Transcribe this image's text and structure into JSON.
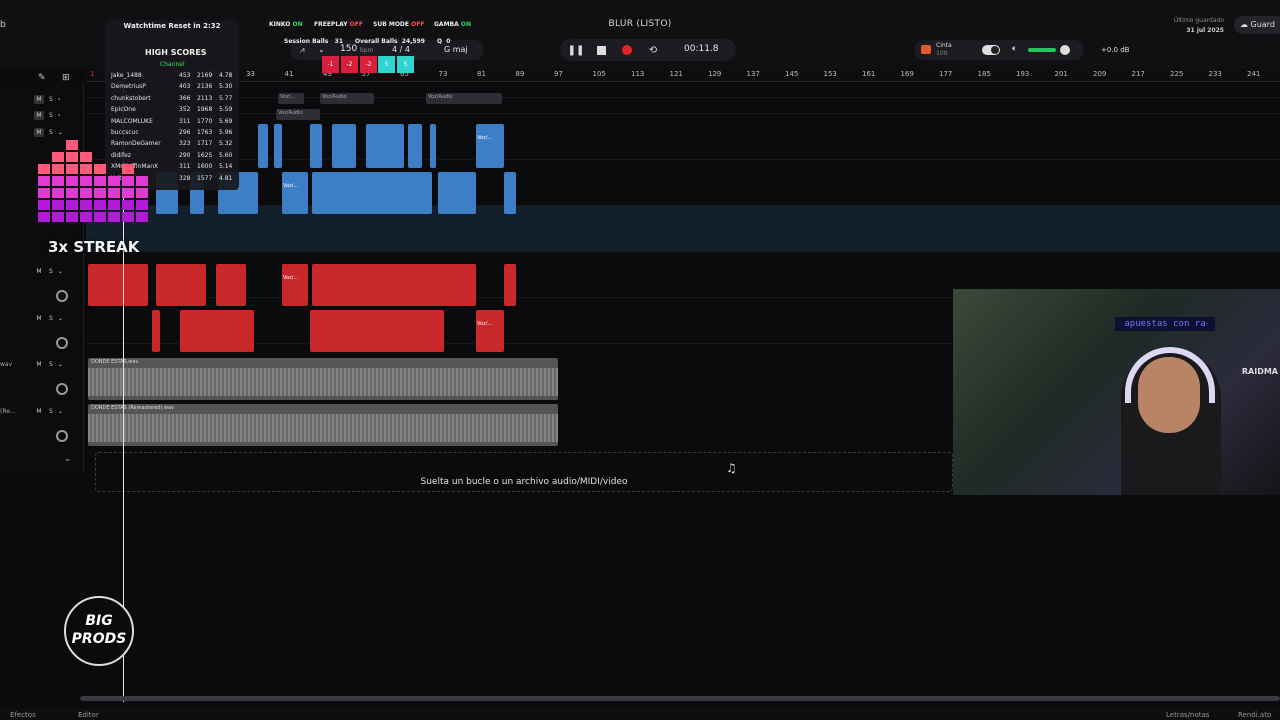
{
  "header": {
    "project_title": "BLUR (LISTO)",
    "saved_label": "Último guardado",
    "saved_date": "31 jul 2025",
    "save_button": "Guard",
    "left_char": "b"
  },
  "stream_overlay": {
    "watchtime": "Watchtime Reset in 2:32",
    "statuses": [
      {
        "name": "KINKO",
        "state": "ON"
      },
      {
        "name": "FREEPLAY",
        "state": "OFF"
      },
      {
        "name": "SUB MODE",
        "state": "OFF"
      },
      {
        "name": "GAMBA",
        "state": "ON"
      }
    ],
    "session_balls_label": "Session Balls",
    "session_balls": "31",
    "overall_balls_label": "Overall Balls",
    "overall_balls": "24,599",
    "extra_q": "Q",
    "extra_zero": "0",
    "high_scores_title": "HIGH SCORES",
    "channel_label": "Channel",
    "scores": [
      {
        "name": "Jake_1488",
        "a": "453",
        "b": "2169",
        "c": "4.78"
      },
      {
        "name": "DemetriusP",
        "a": "403",
        "b": "2136",
        "c": "5.30"
      },
      {
        "name": "chunkstobert",
        "a": "366",
        "b": "2113",
        "c": "5.77"
      },
      {
        "name": "EpicOne",
        "a": "352",
        "b": "1968",
        "c": "5.59"
      },
      {
        "name": "MALCOMLUKE",
        "a": "311",
        "b": "1770",
        "c": "5.69"
      },
      {
        "name": "buccscuc",
        "a": "296",
        "b": "1763",
        "c": "5.96"
      },
      {
        "name": "RamonDeGamer",
        "a": "323",
        "b": "1717",
        "c": "5.32"
      },
      {
        "name": "didifez",
        "a": "290",
        "b": "1625",
        "c": "5.60"
      },
      {
        "name": "XMrMuffinManX",
        "a": "311",
        "b": "1600",
        "c": "5.14"
      },
      {
        "name": "Yoitsw",
        "a": "328",
        "b": "1577",
        "c": "4.81"
      }
    ],
    "tiles": [
      "-1",
      "-2",
      "-2",
      "5",
      "5"
    ],
    "streak": "3x STREAK"
  },
  "tempo": {
    "bpm": "150",
    "bpm_unit": "bpm",
    "signature": "4 / 4",
    "key": "G maj"
  },
  "transport": {
    "time": "00:11.8"
  },
  "output": {
    "cinta_label": "Cinta",
    "cinta_value": "100",
    "db": "+0.0 dB"
  },
  "ruler": {
    "first": "1",
    "marks": [
      "17",
      "25",
      "33",
      "41",
      "49",
      "57",
      "65",
      "73",
      "81",
      "89",
      "97",
      "105",
      "113",
      "121",
      "129",
      "137",
      "145",
      "153",
      "161",
      "169",
      "177",
      "185",
      "193",
      "201",
      "209",
      "217",
      "225",
      "233",
      "241"
    ]
  },
  "tracks": {
    "mute": "M",
    "solo": "S",
    "label_wav": "wav",
    "label_re": "(Re..."
  },
  "clips": {
    "voz_audio": "Voz/Audio",
    "voz_short": "Voz/...",
    "audio1": "DONDE ESTAS.wav",
    "audio2": "DONDE ESTAS (Remastered).wav"
  },
  "dropzone": {
    "text": "Suelta un bucle o un archivo audio/MIDI/video"
  },
  "webcam": {
    "sign": "apuestas con ra",
    "raid": "RAIDMA"
  },
  "logo": {
    "line1": "BIG",
    "line2": "PRODS"
  },
  "bottom": {
    "effects": "Efectos",
    "editor": "Editor",
    "lyrics": "Letras/notas",
    "right": "Rendi.ato"
  }
}
